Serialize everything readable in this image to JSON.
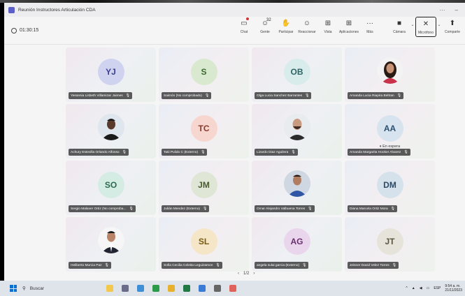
{
  "window": {
    "title": "Reunión Instructores Articulación CDA"
  },
  "meeting": {
    "elapsed": "01:30:15"
  },
  "toolbar": {
    "chat": "Chat",
    "people": "Gente",
    "people_count": "32",
    "raise": "Participar",
    "react": "Reaccionar",
    "view": "Vista",
    "apps": "Aplicaciones",
    "more": "Más",
    "camera": "Cámara",
    "mic": "Micrófono",
    "share": "Comparte"
  },
  "participants": [
    {
      "name": "Yessenia Lisbeth Villamizar Jaimes",
      "initials": "YJ",
      "bg": "#cfd3ef",
      "fg": "#3b3f8f"
    },
    {
      "name": "Saimón (No comprobado)",
      "initials": "S",
      "bg": "#d8e9d0",
      "fg": "#3a6b2a"
    },
    {
      "name": "Olga Lucia Sanchez Barrantes",
      "initials": "OB",
      "bg": "#d9ecec",
      "fg": "#2e6464"
    },
    {
      "name": "Amanda Lucia Riapira Beltran",
      "photo": "woman"
    },
    {
      "name": "Achury Estevilla Orlando Alfonso",
      "photo": "man-dark"
    },
    {
      "name": "Tatii Pulido C (Externo)",
      "initials": "TC",
      "bg": "#f6d6cf",
      "fg": "#8a3a2a"
    },
    {
      "name": "Lizardo Diaz Aguilera",
      "photo": "man-bald"
    },
    {
      "name": "Amanda Margarita Hooker Alvarez",
      "initials": "AA",
      "bg": "#d7e3ee",
      "fg": "#2d4f6e",
      "status": "En espera"
    },
    {
      "name": "Sergio Malaver Ortiz (No comproba...",
      "initials": "SO",
      "bg": "#d5ece4",
      "fg": "#2a6a4e"
    },
    {
      "name": "Julián Mendez (Externo)",
      "initials": "JM",
      "bg": "#dfe6d6",
      "fg": "#4a5a30"
    },
    {
      "name": "Omar Alejandro Valbuena Torres",
      "photo": "man-blue"
    },
    {
      "name": "Diana Marcela Ortiz Mora",
      "initials": "DM",
      "bg": "#d5e2ec",
      "fg": "#2b4a66"
    },
    {
      "name": "Heliberto Murcia Paz",
      "photo": "man-suit"
    },
    {
      "name": "Sofia Cecilia Celeita Leguizamon",
      "initials": "SL",
      "bg": "#f4e6c6",
      "fg": "#7a5a12"
    },
    {
      "name": "angela sulai garcia (Externo)",
      "initials": "AG",
      "bg": "#ead6ec",
      "fg": "#6a2f70"
    },
    {
      "name": "Jeisner David Velez Torres",
      "initials": "JT",
      "bg": "#e6e3da",
      "fg": "#5a5440"
    }
  ],
  "pager": {
    "label": "1/2"
  },
  "taskbar": {
    "search": "Buscar",
    "lang": "ESP",
    "time": "9:54 a. m.",
    "date": "21/11/2023"
  }
}
